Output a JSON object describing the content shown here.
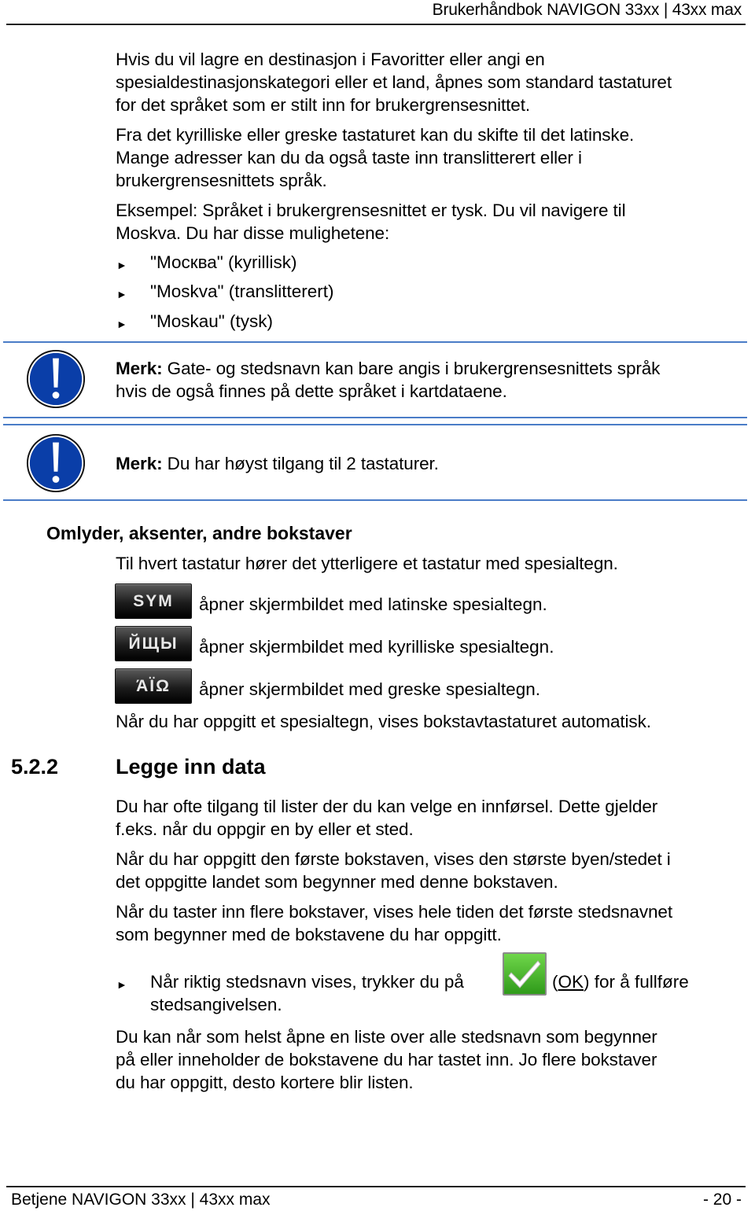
{
  "header": {
    "title": "Brukerhåndbok NAVIGON 33xx | 43xx max"
  },
  "intro": {
    "p1": [
      "Hvis du vil lagre en destinasjon i Favoritter eller angi en",
      "spesialdestinasjonskategori eller et land, åpnes som standard tastaturet",
      "for det språket som er stilt inn for brukergrensesnittet."
    ],
    "p2": [
      "Fra det kyrilliske eller greske tastaturet kan du skifte til det latinske.",
      "Mange adresser kan du da også taste inn translitterert eller i",
      "brukergrensesnittets språk."
    ],
    "p3": [
      "Eksempel: Språket i brukergrensesnittet er tysk. Du vil navigere til",
      "Moskva. Du har disse mulighetene:"
    ],
    "bullets": [
      "\"Москва\" (kyrillisk)",
      "\"Moskva\" (translitterert)",
      "\"Moskau\" (tysk)"
    ]
  },
  "notes": [
    {
      "label": "Merk:",
      "lines": [
        " Gate- og stedsnavn kan bare angis i brukergrensesnittets språk",
        "hvis de også finnes på dette språket i kartdataene."
      ],
      "icon": "warning-exclamation-icon",
      "color": "#0a3ea8"
    },
    {
      "label": "Merk:",
      "lines": [
        " Du har høyst tilgang til 2 tastaturer."
      ],
      "icon": "warning-exclamation-icon",
      "color": "#0a3ea8"
    }
  ],
  "special": {
    "heading": "Omlyder, aksenter, andre bokstaver",
    "intro": "Til hvert tastatur hører det ytterligere et tastatur med spesialtegn.",
    "keys": [
      {
        "key": "SYM",
        "desc": "åpner skjermbildet med latinske spesialtegn."
      },
      {
        "key": "ЙЩЫ",
        "desc": "åpner skjermbildet med kyrilliske spesialtegn."
      },
      {
        "key": "ΆΪΩ",
        "desc": "åpner skjermbildet med greske spesialtegn."
      }
    ],
    "outro": "Når du har oppgitt et spesialtegn, vises bokstavtastaturet automatisk."
  },
  "section": {
    "number": "5.2.2",
    "title": "Legge inn data",
    "p1": [
      "Du har ofte tilgang til lister der du kan velge en innførsel. Dette gjelder",
      "f.eks. når du oppgir en by eller et sted."
    ],
    "p2": [
      "Når du har oppgitt den første bokstaven, vises den største byen/stedet i",
      "det oppgitte landet som begynner med denne bokstaven."
    ],
    "p3": [
      "Når du taster inn flere bokstaver, vises hele tiden det første stedsnavnet",
      "som begynner med de bokstavene du har oppgitt."
    ],
    "step": {
      "before": "Når riktig stedsnavn vises, trykker du på",
      "ok_open": "(",
      "ok_label": "OK",
      "ok_close": ")",
      "after": " for å fullføre",
      "line2": "stedsangivelsen."
    },
    "p4": [
      "Du kan når som helst åpne en liste over alle stedsnavn som begynner",
      "på eller inneholder de bokstavene du har tastet inn. Jo flere bokstaver",
      "du har oppgitt, desto kortere blir listen."
    ]
  },
  "footer": {
    "left": "Betjene NAVIGON 33xx | 43xx max",
    "right": "- 20 -"
  }
}
